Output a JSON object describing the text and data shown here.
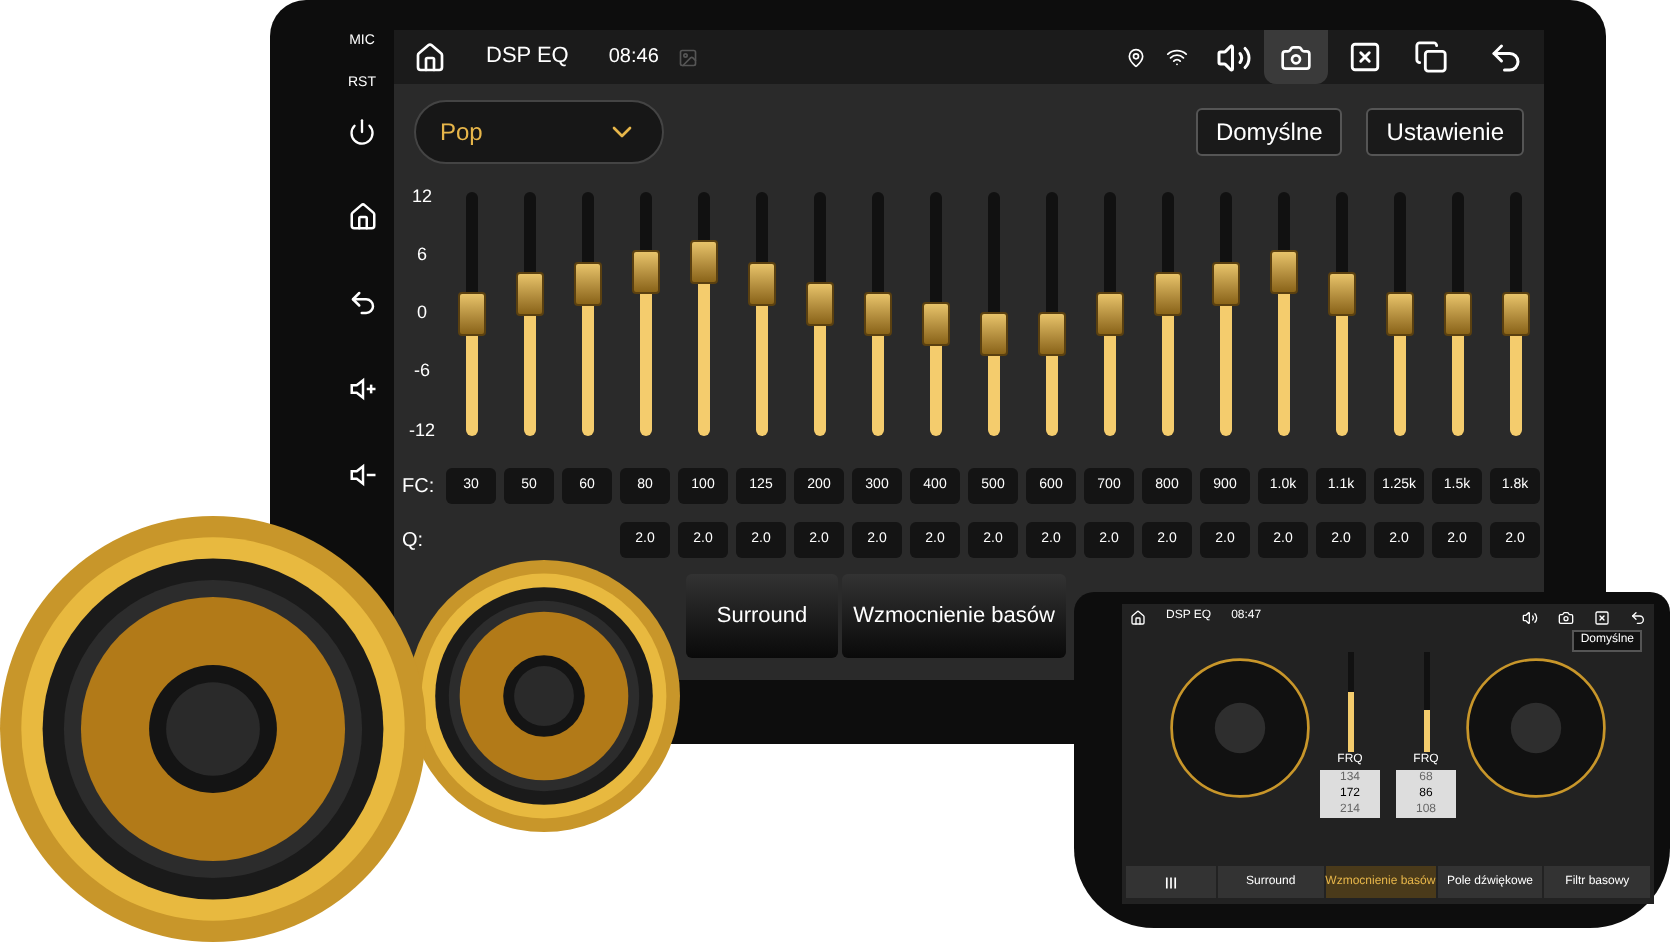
{
  "main_unit": {
    "side_panel": {
      "labels": [
        "MIC",
        "RST"
      ]
    },
    "status_bar": {
      "title": "DSP EQ",
      "time": "08:46"
    },
    "preset": {
      "value": "Pop"
    },
    "buttons": [
      "Domyślne",
      "Ustawienie"
    ],
    "eq": {
      "y_labels": [
        "12",
        "6",
        "0",
        "-6",
        "-12"
      ],
      "fc_label": "FC:",
      "q_label": "Q:",
      "bands": [
        {
          "fc": "30",
          "level": 0.5
        },
        {
          "fc": "50",
          "level": 0.58
        },
        {
          "fc": "60",
          "level": 0.62
        },
        {
          "fc": "80",
          "level": 0.67
        },
        {
          "fc": "100",
          "level": 0.71
        },
        {
          "fc": "125",
          "level": 0.62
        },
        {
          "fc": "200",
          "level": 0.54
        },
        {
          "fc": "300",
          "level": 0.5
        },
        {
          "fc": "400",
          "level": 0.46
        },
        {
          "fc": "500",
          "level": 0.42
        },
        {
          "fc": "600",
          "level": 0.42
        },
        {
          "fc": "700",
          "level": 0.5
        },
        {
          "fc": "800",
          "level": 0.58
        },
        {
          "fc": "900",
          "level": 0.62
        },
        {
          "fc": "1.0k",
          "level": 0.67
        },
        {
          "fc": "1.1k",
          "level": 0.58
        },
        {
          "fc": "1.25k",
          "level": 0.5
        },
        {
          "fc": "1.5k",
          "level": 0.5
        },
        {
          "fc": "1.8k",
          "level": 0.5
        }
      ],
      "q_values": [
        "2.0",
        "2.0",
        "2.0",
        "2.0",
        "2.0",
        "2.0",
        "2.0",
        "2.0",
        "2.0",
        "2.0",
        "2.0",
        "2.0",
        "2.0",
        "2.0",
        "2.0",
        "2.0"
      ]
    },
    "modes": [
      {
        "label": "Surround",
        "selected": false
      },
      {
        "label": "Wzmocnienie basów",
        "selected": false
      }
    ]
  },
  "mini_unit": {
    "status_bar": {
      "title": "DSP EQ",
      "time": "08:47"
    },
    "button": "Domyślne",
    "channels": [
      {
        "label": "FRQ",
        "values": [
          "134",
          "172",
          "214"
        ],
        "level": 0.6
      },
      {
        "label": "FRQ",
        "values": [
          "68",
          "86",
          "108"
        ],
        "level": 0.42
      }
    ],
    "modes": [
      {
        "label": "Surround",
        "selected": false
      },
      {
        "label": "Wzmocnienie basów",
        "selected": true
      },
      {
        "label": "Pole dźwiękowe",
        "selected": false
      },
      {
        "label": "Filtr basowy",
        "selected": false
      }
    ]
  }
}
